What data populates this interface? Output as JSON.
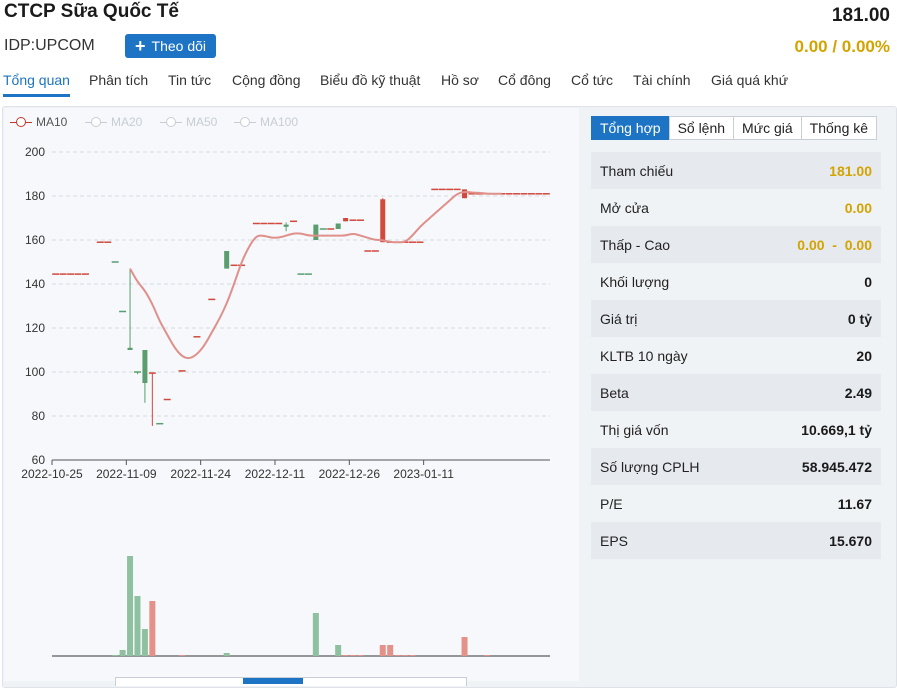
{
  "header": {
    "company_name": "CTCP Sữa Quốc Tế",
    "ticker": "IDP:UPCOM",
    "follow_label": "Theo dõi",
    "price": "181.00",
    "change": "0.00 / 0.00%"
  },
  "tabs": [
    {
      "label": "Tổng quan",
      "active": true
    },
    {
      "label": "Phân tích"
    },
    {
      "label": "Tin tức"
    },
    {
      "label": "Cộng đồng"
    },
    {
      "label": "Biểu đồ kỹ thuật"
    },
    {
      "label": "Hồ sơ"
    },
    {
      "label": "Cổ đông"
    },
    {
      "label": "Cổ tức"
    },
    {
      "label": "Tài chính"
    },
    {
      "label": "Giá quá khứ"
    }
  ],
  "legend": [
    {
      "label": "MA10",
      "color": "#c0392b",
      "active": true
    },
    {
      "label": "MA20",
      "color": "#c8cdd3"
    },
    {
      "label": "MA50",
      "color": "#c8cdd3"
    },
    {
      "label": "MA100",
      "color": "#c8cdd3"
    }
  ],
  "chart_data": {
    "type": "candlestick",
    "x_tick_labels": [
      "2022-10-25",
      "2022-11-09",
      "2022-11-24",
      "2022-12-11",
      "2022-12-26",
      "2023-01-11"
    ],
    "y_ticks": [
      60,
      80,
      100,
      120,
      140,
      160,
      180,
      200
    ],
    "ylim": [
      60,
      200
    ],
    "grid": true,
    "colors": {
      "up": "#5a9e6f",
      "down": "#d1483d",
      "flat_up": "#5a9e6f",
      "flat_down": "#d1483d",
      "ma": "#e0908a",
      "volume_up": "#8fc1a0",
      "volume_down": "#e4918a"
    },
    "candles": [
      {
        "i": 0,
        "o": 144.5,
        "c": 144.5,
        "h": 144.5,
        "l": 144.5,
        "v": 0,
        "d": "down"
      },
      {
        "i": 1,
        "o": 144.5,
        "c": 144.5,
        "h": 144.5,
        "l": 144.5,
        "v": 0,
        "d": "down"
      },
      {
        "i": 2,
        "o": 144.5,
        "c": 144.5,
        "h": 144.5,
        "l": 144.5,
        "v": 0,
        "d": "down"
      },
      {
        "i": 3,
        "o": 144.5,
        "c": 144.5,
        "h": 144.5,
        "l": 144.5,
        "v": 0,
        "d": "down"
      },
      {
        "i": 4,
        "o": 144.5,
        "c": 144.5,
        "h": 144.5,
        "l": 144.5,
        "v": 0,
        "d": "down"
      },
      {
        "i": 6,
        "o": 159.0,
        "c": 159.0,
        "h": 159.0,
        "l": 159.0,
        "v": 0,
        "d": "down"
      },
      {
        "i": 7,
        "o": 159.0,
        "c": 159.0,
        "h": 159.0,
        "l": 159.0,
        "v": 0,
        "d": "down"
      },
      {
        "i": 8,
        "o": 150.0,
        "c": 150.0,
        "h": 150.0,
        "l": 150.0,
        "v": 1,
        "d": "up"
      },
      {
        "i": 9,
        "o": 127.5,
        "c": 127.5,
        "h": 127.5,
        "l": 127.5,
        "v": 6,
        "d": "up"
      },
      {
        "i": 10,
        "o": 111.0,
        "c": 110.0,
        "h": 147.0,
        "l": 110.0,
        "v": 100,
        "d": "up"
      },
      {
        "i": 11,
        "o": 99.5,
        "c": 100.0,
        "h": 100.0,
        "l": 99.0,
        "v": 60,
        "d": "up"
      },
      {
        "i": 12,
        "o": 95.0,
        "c": 110.0,
        "h": 110.0,
        "l": 86.0,
        "v": 27,
        "d": "up"
      },
      {
        "i": 13,
        "o": 99.5,
        "c": 99.5,
        "h": 99.5,
        "l": 75.5,
        "v": 55,
        "d": "down"
      },
      {
        "i": 14,
        "o": 76.5,
        "c": 76.5,
        "h": 76.5,
        "l": 76.5,
        "v": 0,
        "d": "up"
      },
      {
        "i": 15,
        "o": 87.5,
        "c": 87.5,
        "h": 87.5,
        "l": 87.5,
        "v": 0,
        "d": "down"
      },
      {
        "i": 17,
        "o": 100.5,
        "c": 100.5,
        "h": 100.5,
        "l": 100.5,
        "v": 1,
        "d": "down"
      },
      {
        "i": 19,
        "o": 116.0,
        "c": 116.0,
        "h": 116.0,
        "l": 116.0,
        "v": 0,
        "d": "down"
      },
      {
        "i": 21,
        "o": 133.0,
        "c": 133.0,
        "h": 133.0,
        "l": 133.0,
        "v": 0,
        "d": "down"
      },
      {
        "i": 23,
        "o": 147.0,
        "c": 155.0,
        "h": 155.0,
        "l": 147.0,
        "v": 3,
        "d": "up"
      },
      {
        "i": 24,
        "o": 148.5,
        "c": 148.5,
        "h": 148.5,
        "l": 148.5,
        "v": 0,
        "d": "down"
      },
      {
        "i": 25,
        "o": 148.5,
        "c": 148.5,
        "h": 148.5,
        "l": 148.5,
        "v": 0,
        "d": "down"
      },
      {
        "i": 27,
        "o": 167.5,
        "c": 167.5,
        "h": 167.5,
        "l": 167.5,
        "v": 0,
        "d": "down"
      },
      {
        "i": 28,
        "o": 167.5,
        "c": 167.5,
        "h": 167.5,
        "l": 167.5,
        "v": 0,
        "d": "down"
      },
      {
        "i": 29,
        "o": 167.5,
        "c": 167.5,
        "h": 167.5,
        "l": 167.5,
        "v": 0,
        "d": "down"
      },
      {
        "i": 30,
        "o": 167.5,
        "c": 167.5,
        "h": 167.5,
        "l": 167.5,
        "v": 0,
        "d": "down"
      },
      {
        "i": 31,
        "o": 167.0,
        "c": 166.0,
        "h": 168.0,
        "l": 164.0,
        "v": 0,
        "d": "up"
      },
      {
        "i": 32,
        "o": 168.5,
        "c": 168.5,
        "h": 168.5,
        "l": 168.5,
        "v": 0,
        "d": "down"
      },
      {
        "i": 33,
        "o": 144.5,
        "c": 144.5,
        "h": 144.5,
        "l": 144.5,
        "v": 0,
        "d": "up"
      },
      {
        "i": 34,
        "o": 144.5,
        "c": 144.5,
        "h": 144.5,
        "l": 144.5,
        "v": 0,
        "d": "up"
      },
      {
        "i": 35,
        "o": 160.0,
        "c": 167.0,
        "h": 167.0,
        "l": 160.0,
        "v": 43,
        "d": "up"
      },
      {
        "i": 36,
        "o": 165.0,
        "c": 165.0,
        "h": 165.0,
        "l": 165.0,
        "v": 0,
        "d": "up"
      },
      {
        "i": 37,
        "o": 165.0,
        "c": 165.0,
        "h": 165.0,
        "l": 165.0,
        "v": 0,
        "d": "down"
      },
      {
        "i": 38,
        "o": 167.5,
        "c": 165.0,
        "h": 167.5,
        "l": 165.0,
        "v": 11,
        "d": "up"
      },
      {
        "i": 39,
        "o": 170.0,
        "c": 168.5,
        "h": 170.0,
        "l": 168.5,
        "v": 1,
        "d": "down"
      },
      {
        "i": 40,
        "o": 169.0,
        "c": 169.0,
        "h": 169.0,
        "l": 169.0,
        "v": 1,
        "d": "down"
      },
      {
        "i": 41,
        "o": 169.0,
        "c": 169.0,
        "h": 169.0,
        "l": 169.0,
        "v": 1,
        "d": "down"
      },
      {
        "i": 42,
        "o": 155.0,
        "c": 155.0,
        "h": 155.0,
        "l": 155.0,
        "v": 0,
        "d": "down"
      },
      {
        "i": 43,
        "o": 155.0,
        "c": 155.0,
        "h": 155.0,
        "l": 155.0,
        "v": 0,
        "d": "down"
      },
      {
        "i": 44,
        "o": 178.5,
        "c": 159.0,
        "h": 179.0,
        "l": 159.0,
        "v": 11,
        "d": "down"
      },
      {
        "i": 45,
        "o": 159.0,
        "c": 159.0,
        "h": 159.0,
        "l": 159.0,
        "v": 11,
        "d": "down"
      },
      {
        "i": 46,
        "o": 159.0,
        "c": 159.0,
        "h": 159.0,
        "l": 159.0,
        "v": 1,
        "d": "down"
      },
      {
        "i": 47,
        "o": 159.0,
        "c": 159.0,
        "h": 159.0,
        "l": 159.0,
        "v": 1,
        "d": "down"
      },
      {
        "i": 48,
        "o": 159.0,
        "c": 159.0,
        "h": 159.0,
        "l": 159.0,
        "v": 1,
        "d": "down"
      },
      {
        "i": 49,
        "o": 159.0,
        "c": 159.0,
        "h": 159.0,
        "l": 159.0,
        "v": 0,
        "d": "down"
      },
      {
        "i": 51,
        "o": 183.0,
        "c": 183.0,
        "h": 183.0,
        "l": 183.0,
        "v": 0,
        "d": "down"
      },
      {
        "i": 52,
        "o": 183.0,
        "c": 183.0,
        "h": 183.0,
        "l": 183.0,
        "v": 0,
        "d": "down"
      },
      {
        "i": 53,
        "o": 183.0,
        "c": 183.0,
        "h": 183.0,
        "l": 183.0,
        "v": 0,
        "d": "down"
      },
      {
        "i": 54,
        "o": 183.0,
        "c": 183.0,
        "h": 183.0,
        "l": 183.0,
        "v": 0,
        "d": "down"
      },
      {
        "i": 55,
        "o": 183.0,
        "c": 179.0,
        "h": 183.0,
        "l": 179.0,
        "v": 19,
        "d": "down"
      },
      {
        "i": 56,
        "o": 181.0,
        "c": 181.0,
        "h": 181.0,
        "l": 181.0,
        "v": 0,
        "d": "down"
      },
      {
        "i": 57,
        "o": 181.0,
        "c": 181.0,
        "h": 181.0,
        "l": 181.0,
        "v": 0,
        "d": "down"
      },
      {
        "i": 58,
        "o": 181.0,
        "c": 181.0,
        "h": 181.0,
        "l": 181.0,
        "v": 1,
        "d": "down"
      },
      {
        "i": 59,
        "o": 181.0,
        "c": 181.0,
        "h": 181.0,
        "l": 181.0,
        "v": 0,
        "d": "down"
      },
      {
        "i": 60,
        "o": 181.0,
        "c": 181.0,
        "h": 181.0,
        "l": 181.0,
        "v": 0,
        "d": "down"
      },
      {
        "i": 61,
        "o": 181.0,
        "c": 181.0,
        "h": 181.0,
        "l": 181.0,
        "v": 0,
        "d": "down"
      },
      {
        "i": 62,
        "o": 181.0,
        "c": 181.0,
        "h": 181.0,
        "l": 181.0,
        "v": 0,
        "d": "down"
      },
      {
        "i": 63,
        "o": 181.0,
        "c": 181.0,
        "h": 181.0,
        "l": 181.0,
        "v": 0,
        "d": "down"
      },
      {
        "i": 64,
        "o": 181.0,
        "c": 181.0,
        "h": 181.0,
        "l": 181.0,
        "v": 0,
        "d": "down"
      },
      {
        "i": 65,
        "o": 181.0,
        "c": 181.0,
        "h": 181.0,
        "l": 181.0,
        "v": 0,
        "d": "down"
      },
      {
        "i": 66,
        "o": 181.0,
        "c": 181.0,
        "h": 181.0,
        "l": 181.0,
        "v": 0,
        "d": "down"
      }
    ],
    "ma10": [
      [
        10,
        147
      ],
      [
        11,
        141
      ],
      [
        12,
        137
      ],
      [
        13,
        131
      ],
      [
        14,
        123
      ],
      [
        15,
        117
      ],
      [
        16,
        111
      ],
      [
        17,
        107
      ],
      [
        18,
        106
      ],
      [
        19,
        108
      ],
      [
        20,
        112
      ],
      [
        21,
        118
      ],
      [
        22,
        124
      ],
      [
        23,
        131
      ],
      [
        24,
        140
      ],
      [
        25,
        150
      ],
      [
        26,
        157
      ],
      [
        27,
        162
      ],
      [
        28,
        162
      ],
      [
        29,
        161
      ],
      [
        30,
        161
      ],
      [
        31,
        162
      ],
      [
        32,
        163
      ],
      [
        33,
        163
      ],
      [
        34,
        162
      ],
      [
        35,
        162
      ],
      [
        36,
        162
      ],
      [
        37,
        162
      ],
      [
        38,
        162
      ],
      [
        39,
        162
      ],
      [
        40,
        163
      ],
      [
        41,
        162
      ],
      [
        42,
        161
      ],
      [
        43,
        160
      ],
      [
        44,
        160
      ],
      [
        45,
        159
      ],
      [
        46,
        159
      ],
      [
        47,
        159
      ],
      [
        48,
        162
      ],
      [
        49,
        166
      ],
      [
        50,
        169
      ],
      [
        51,
        172
      ],
      [
        52,
        175
      ],
      [
        53,
        178
      ],
      [
        54,
        181
      ],
      [
        55,
        182
      ],
      [
        56,
        181.5
      ],
      [
        57,
        181.5
      ],
      [
        58,
        181
      ],
      [
        59,
        181
      ],
      [
        60,
        181
      ]
    ],
    "volume_max": 100
  },
  "side": {
    "tabs": [
      {
        "label": "Tổng hợp",
        "active": true
      },
      {
        "label": "Sổ lệnh"
      },
      {
        "label": "Mức giá"
      },
      {
        "label": "Thống kê"
      }
    ],
    "rows": [
      {
        "label": "Tham chiếu",
        "value": "181.00",
        "gold": true
      },
      {
        "label": "Mở cửa",
        "value": "0.00",
        "gold": true
      },
      {
        "label": "Thấp - Cao",
        "value": "0.00  -  0.00",
        "gold": true
      },
      {
        "label": "Khối lượng",
        "value": "0"
      },
      {
        "label": "Giá trị",
        "value": "0 tỷ"
      },
      {
        "label": "KLTB 10 ngày",
        "value": "20"
      },
      {
        "label": "Beta",
        "value": "2.49"
      },
      {
        "label": "Thị giá vốn",
        "value": "10.669,1 tỷ"
      },
      {
        "label": "Số lượng CPLH",
        "value": "58.945.472"
      },
      {
        "label": "P/E",
        "value": "11.67"
      },
      {
        "label": "EPS",
        "value": "15.670"
      }
    ]
  }
}
